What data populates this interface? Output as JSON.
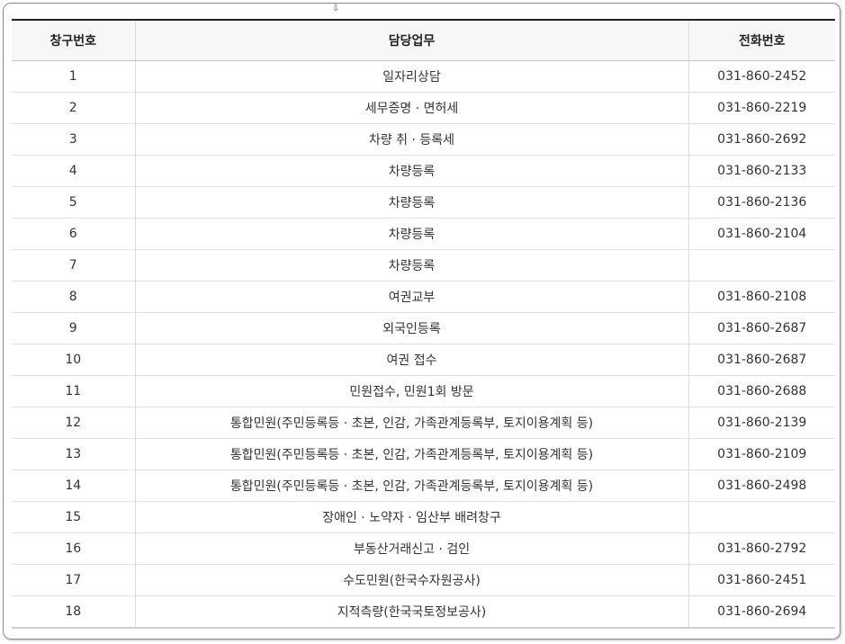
{
  "handle_icon": "drag-arrow-icon",
  "table": {
    "headers": [
      "창구번호",
      "담당업무",
      "전화번호"
    ],
    "rows": [
      {
        "no": "1",
        "duty": "일자리상담",
        "phone": "031-860-2452"
      },
      {
        "no": "2",
        "duty": "세무증명 · 면허세",
        "phone": "031-860-2219"
      },
      {
        "no": "3",
        "duty": "차량 취 · 등록세",
        "phone": "031-860-2692"
      },
      {
        "no": "4",
        "duty": "차량등록",
        "phone": "031-860-2133"
      },
      {
        "no": "5",
        "duty": "차량등록",
        "phone": "031-860-2136"
      },
      {
        "no": "6",
        "duty": "차량등록",
        "phone": "031-860-2104"
      },
      {
        "no": "7",
        "duty": "차량등록",
        "phone": ""
      },
      {
        "no": "8",
        "duty": "여권교부",
        "phone": "031-860-2108"
      },
      {
        "no": "9",
        "duty": "외국인등록",
        "phone": "031-860-2687"
      },
      {
        "no": "10",
        "duty": "여권 접수",
        "phone": "031-860-2687"
      },
      {
        "no": "11",
        "duty": "민원접수, 민원1회 방문",
        "phone": "031-860-2688"
      },
      {
        "no": "12",
        "duty": "통합민원(주민등록등 · 초본, 인감, 가족관계등록부, 토지이용계획 등)",
        "phone": "031-860-2139"
      },
      {
        "no": "13",
        "duty": "통합민원(주민등록등 · 초본, 인감, 가족관계등록부, 토지이용계획 등)",
        "phone": "031-860-2109"
      },
      {
        "no": "14",
        "duty": "통합민원(주민등록등 · 초본, 인감, 가족관계등록부, 토지이용계획 등)",
        "phone": "031-860-2498"
      },
      {
        "no": "15",
        "duty": "장애인 · 노약자 · 임산부 배려창구",
        "phone": ""
      },
      {
        "no": "16",
        "duty": "부동산거래신고 · 검인",
        "phone": "031-860-2792"
      },
      {
        "no": "17",
        "duty": "수도민원(한국수자원공사)",
        "phone": "031-860-2451"
      },
      {
        "no": "18",
        "duty": "지적측량(한국국토정보공사)",
        "phone": "031-860-2694"
      }
    ]
  }
}
